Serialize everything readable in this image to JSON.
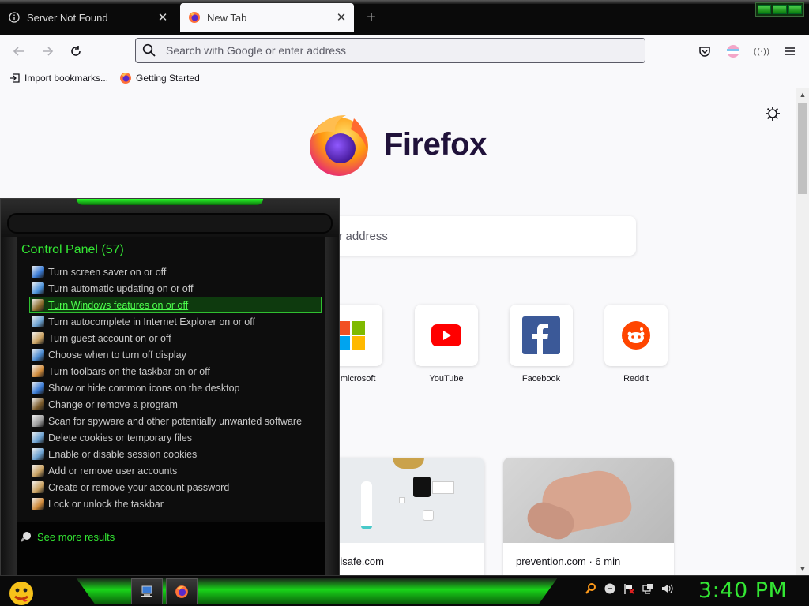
{
  "tabs": [
    {
      "label": "Server Not Found",
      "icon": "info-icon",
      "active": false
    },
    {
      "label": "New Tab",
      "icon": "firefox-icon",
      "active": true
    }
  ],
  "nav": {
    "url_placeholder": "Search with Google or enter address"
  },
  "bookmarks": [
    {
      "label": "Import bookmarks...",
      "icon": "import-icon"
    },
    {
      "label": "Getting Started",
      "icon": "firefox-icon"
    }
  ],
  "newtab": {
    "brand": "Firefox",
    "search_visible_text": "er address",
    "top_sites": [
      {
        "label": "ant.microsoft",
        "icon": "microsoft-icon"
      },
      {
        "label": "YouTube",
        "icon": "youtube-icon"
      },
      {
        "label": "Facebook",
        "icon": "facebook-icon"
      },
      {
        "label": "Reddit",
        "icon": "reddit-icon"
      }
    ],
    "stories": [
      {
        "source": "nplisafe.com"
      },
      {
        "source": "prevention.com · 6 min"
      }
    ]
  },
  "start_menu": {
    "section_title": "Control Panel (57)",
    "items": [
      {
        "label": "Turn screen saver on or off",
        "color": "#3a7bd5"
      },
      {
        "label": "Turn automatic updating on or off",
        "color": "#4a90d9"
      },
      {
        "label": "Turn Windows features on or off",
        "color": "#8a6a2a",
        "selected": true
      },
      {
        "label": "Turn autocomplete in Internet Explorer on or off",
        "color": "#6aa0d0"
      },
      {
        "label": "Turn guest account on or off",
        "color": "#c8a060"
      },
      {
        "label": "Choose when to turn off display",
        "color": "#4a8ad0"
      },
      {
        "label": "Turn toolbars on the taskbar on or off",
        "color": "#d08a3a"
      },
      {
        "label": "Show or hide common icons on the desktop",
        "color": "#3a7bd5"
      },
      {
        "label": "Change or remove a program",
        "color": "#7a5a2a"
      },
      {
        "label": "Scan for spyware and other potentially unwanted software",
        "color": "#9a9a9a"
      },
      {
        "label": "Delete cookies or temporary files",
        "color": "#6aa0d0"
      },
      {
        "label": "Enable or disable session cookies",
        "color": "#6aa0d0"
      },
      {
        "label": "Add or remove user accounts",
        "color": "#c8a060"
      },
      {
        "label": "Create or remove your account password",
        "color": "#c8a060"
      },
      {
        "label": "Lock or unlock the taskbar",
        "color": "#d08a3a"
      }
    ],
    "see_more": "See more results"
  },
  "taskbar": {
    "clock": "3:40 PM",
    "accent": "#19d519"
  }
}
